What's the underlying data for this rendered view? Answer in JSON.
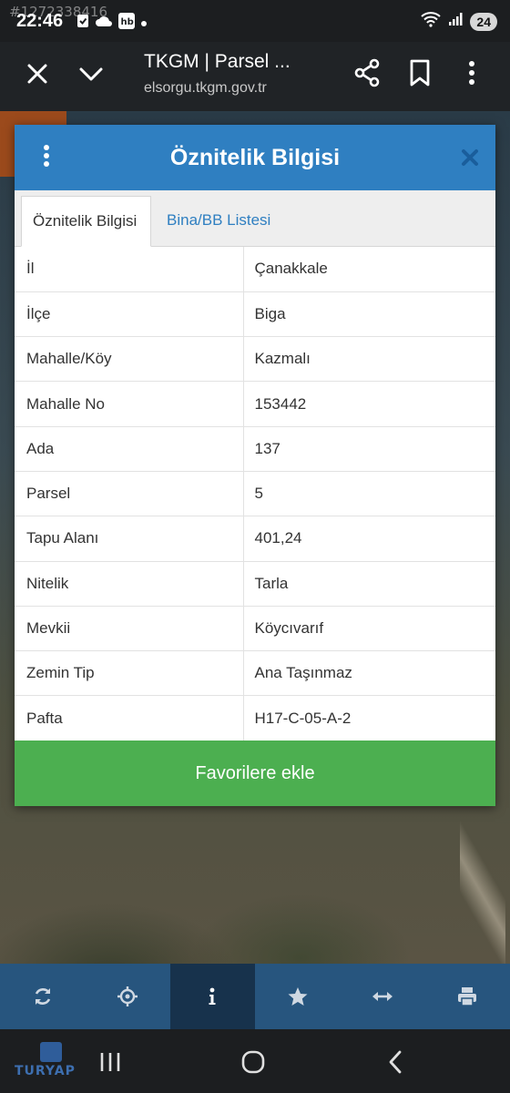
{
  "status_bar": {
    "watermark": "#1272338416",
    "time": "22:46",
    "battery": "24",
    "icons": [
      "message-icon",
      "cloud-icon",
      "hb-icon",
      "dot-icon",
      "wifi-icon",
      "signal-icon"
    ]
  },
  "browser": {
    "title": "TKGM | Parsel ...",
    "url": "elsorgu.tkgm.gov.tr"
  },
  "dialog": {
    "title": "Öznitelik Bilgisi",
    "tabs": [
      {
        "label": "Öznitelik Bilgisi",
        "active": true
      },
      {
        "label": "Bina/BB Listesi",
        "active": false
      }
    ],
    "rows": [
      {
        "key": "İl",
        "value": "Çanakkale"
      },
      {
        "key": "İlçe",
        "value": "Biga"
      },
      {
        "key": "Mahalle/Köy",
        "value": "Kazmalı"
      },
      {
        "key": "Mahalle No",
        "value": "153442"
      },
      {
        "key": "Ada",
        "value": "137"
      },
      {
        "key": "Parsel",
        "value": "5"
      },
      {
        "key": "Tapu Alanı",
        "value": "401,24"
      },
      {
        "key": "Nitelik",
        "value": "Tarla"
      },
      {
        "key": "Mevkii",
        "value": "Köycıvarıf"
      },
      {
        "key": "Zemin Tip",
        "value": "Ana Taşınmaz"
      },
      {
        "key": "Pafta",
        "value": "H17-C-05-A-2"
      }
    ],
    "favorite_button": "Favorilere ekle"
  },
  "toolbar": {
    "tools": [
      "refresh-icon",
      "crosshair-icon",
      "info-icon",
      "star-icon",
      "measure-icon",
      "print-icon"
    ],
    "active": "info-icon"
  },
  "navbar": {
    "logo_text": "TURYAP"
  },
  "colors": {
    "header_blue": "#2f7fc1",
    "button_green": "#4caf50",
    "toolbar_blue": "#27557e",
    "toolbar_active": "#17324c"
  }
}
